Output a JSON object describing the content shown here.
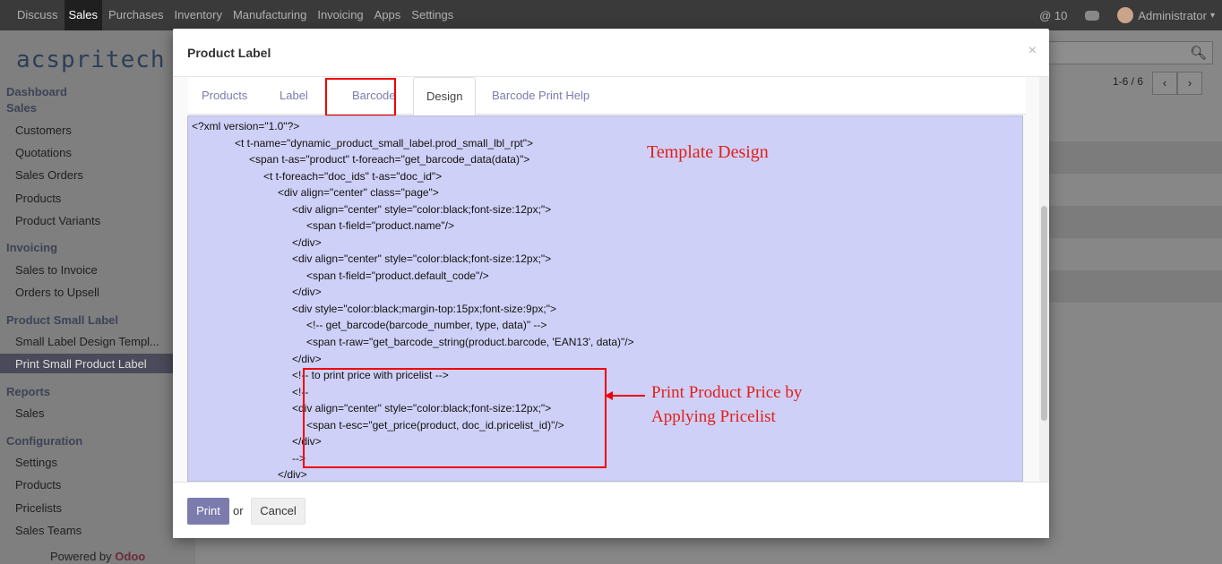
{
  "topbar": {
    "menu": [
      "Discuss",
      "Sales",
      "Purchases",
      "Inventory",
      "Manufacturing",
      "Invoicing",
      "Apps",
      "Settings"
    ],
    "active": "Sales",
    "messages_count": "@ 10",
    "user": "Administrator"
  },
  "logo_text": "acspritech",
  "sidebar": {
    "sections": [
      {
        "title": "Dashboard",
        "items": []
      },
      {
        "title": "Sales",
        "items": [
          "Customers",
          "Quotations",
          "Sales Orders",
          "Products",
          "Product Variants"
        ]
      },
      {
        "title": "Invoicing",
        "items": [
          "Sales to Invoice",
          "Orders to Upsell"
        ]
      },
      {
        "title": "Product Small Label",
        "items": [
          "Small Label Design Templ...",
          "Print Small Product Label"
        ]
      },
      {
        "title": "Reports",
        "items": [
          "Sales"
        ]
      },
      {
        "title": "Configuration",
        "items": [
          "Settings",
          "Products",
          "Pricelists",
          "Sales Teams"
        ]
      }
    ],
    "selected": "Print Small Product Label",
    "powered_by": "Powered by",
    "powered_brand": "Odoo"
  },
  "main": {
    "pager": "1-6 / 6",
    "prev": "‹",
    "next": "›"
  },
  "modal": {
    "title": "Product Label",
    "close": "×",
    "tabs": [
      "Products",
      "Label",
      "Barcode",
      "Design",
      "Barcode Print Help"
    ],
    "active_tab": "Design",
    "highlighted_tab": "Barcode",
    "code_lines": [
      "<?xml version=\"1.0\"?>",
      "<t t-name=\"dynamic_product_small_label.prod_small_lbl_rpt\">",
      "<span t-as=\"product\" t-foreach=\"get_barcode_data(data)\">",
      "<t t-foreach=\"doc_ids\" t-as=\"doc_id\">",
      "<div align=\"center\" class=\"page\">",
      "<div align=\"center\" style=\"color:black;font-size:12px;\">",
      "<span t-field=\"product.name\"/>",
      "</div>",
      "<div align=\"center\" style=\"color:black;font-size:12px;\">",
      "<span t-field=\"product.default_code\"/>",
      "</div>",
      "<div style=\"color:black;margin-top:15px;font-size:9px;\">",
      "<!-- get_barcode(barcode_number, type, data)\" -->",
      "<span t-raw=\"get_barcode_string(product.barcode, 'EAN13', data)\"/>",
      "</div>",
      "<!-- to print price with pricelist -->",
      "<!--",
      "<div align=\"center\" style=\"color:black;font-size:12px;\">",
      "<span t-esc=\"get_price(product, doc_id.pricelist_id)\"/>",
      "</div>",
      "-->",
      "</div>"
    ],
    "annotation_design": "Template Design",
    "annotation_price_line1": "Print Product Price by",
    "annotation_price_line2": "Applying Pricelist",
    "print_label": "Print",
    "or_label": "or",
    "cancel_label": "Cancel"
  },
  "colors": {
    "accent": "#7c7bad",
    "annotation": "#e0201a",
    "code_bg": "#cfd0f7",
    "topbar": "#3a3a3a"
  }
}
